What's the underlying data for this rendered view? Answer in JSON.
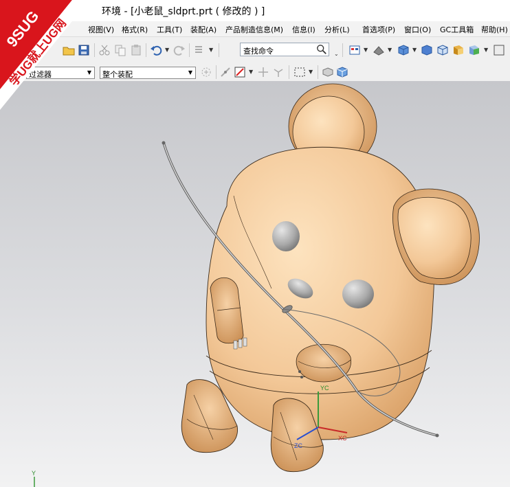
{
  "window": {
    "title": "环境 - [小老鼠_sldprt.prt  ( 修改的 ) ]"
  },
  "watermark": {
    "line1": "9SUG",
    "line2": "学UG就上UG网",
    "color": "#d9151c"
  },
  "menu": {
    "items": [
      {
        "label": "视图(V)"
      },
      {
        "label": "格式(R)"
      },
      {
        "label": "工具(T)"
      },
      {
        "label": "装配(A)"
      },
      {
        "label": "产品制造信息(M)"
      },
      {
        "label": "信息(I)"
      },
      {
        "label": "分析(L)"
      },
      {
        "label": "首选项(P)"
      },
      {
        "label": "窗口(O)"
      },
      {
        "label": "GC工具箱"
      },
      {
        "label": "帮助(H)"
      }
    ]
  },
  "toolbar": {
    "command_search": "查找命令",
    "filter_select": "过滤器",
    "assembly_select": "整个装配"
  },
  "icons": [
    "open-icon",
    "save-icon",
    "cut-icon",
    "copy-icon",
    "paste-icon",
    "undo-icon",
    "redo-icon",
    "repeat-command-icon",
    "search-icon",
    "view-orient-icon",
    "render-style-icon",
    "cube-view-icon",
    "select-filter-icon",
    "snap-point-icon",
    "box-select-icon"
  ],
  "viewport": {
    "model_color": "#f3c898",
    "eye_color": "#a9a9a9",
    "axes": {
      "x_label": "XC",
      "y_label": "YC",
      "z_label": "ZC",
      "world_y_label": "Y"
    }
  }
}
